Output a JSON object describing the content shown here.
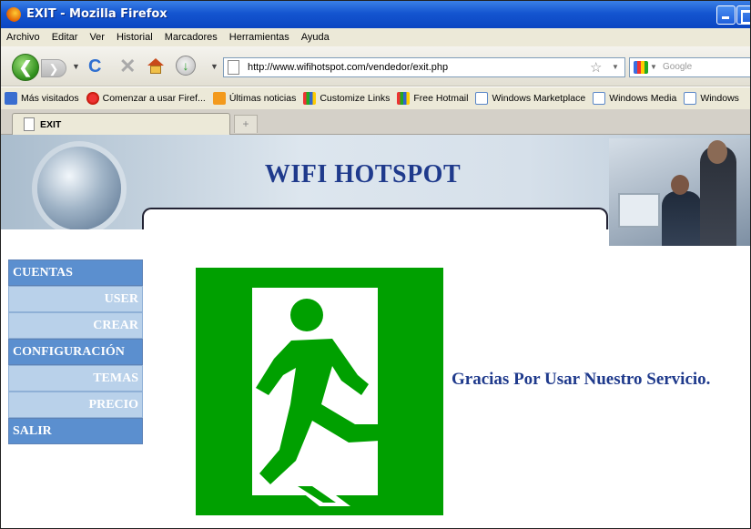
{
  "window": {
    "title": "EXIT - Mozilla Firefox"
  },
  "menubar": {
    "items": [
      "Archivo",
      "Editar",
      "Ver",
      "Historial",
      "Marcadores",
      "Herramientas",
      "Ayuda"
    ]
  },
  "navbar": {
    "url": "http://www.wifihotspot.com/vendedor/exit.php",
    "search_placeholder": "Google"
  },
  "bookmarks": {
    "items": [
      {
        "label": "Más visitados",
        "icon": "visited-icon"
      },
      {
        "label": "Comenzar a usar Firef...",
        "icon": "firefox-icon"
      },
      {
        "label": "Últimas noticias",
        "icon": "rss-icon"
      },
      {
        "label": "Customize Links",
        "icon": "windows-logo-icon"
      },
      {
        "label": "Free Hotmail",
        "icon": "windows-logo-icon"
      },
      {
        "label": "Windows Marketplace",
        "icon": "page-icon"
      },
      {
        "label": "Windows Media",
        "icon": "page-icon"
      },
      {
        "label": "Windows",
        "icon": "page-icon"
      }
    ]
  },
  "tabs": [
    {
      "label": "EXIT"
    }
  ],
  "page": {
    "banner_title": "WIFI HOTSPOT",
    "menu": [
      {
        "label": "CUENTAS",
        "level": "main"
      },
      {
        "label": "USER",
        "level": "sub"
      },
      {
        "label": "CREAR",
        "level": "sub"
      },
      {
        "label": "CONFIGURACIÓN",
        "level": "main"
      },
      {
        "label": "TEMAS",
        "level": "sub"
      },
      {
        "label": "PRECIO",
        "level": "sub"
      },
      {
        "label": "SALIR",
        "level": "main"
      }
    ],
    "thanks_message": "Gracias Por Usar Nuestro Servicio.",
    "colors": {
      "exit_sign_green": "#00a000",
      "heading_blue": "#1f3a8c",
      "menu_main": "#5b8fcf",
      "menu_sub": "#b9d1ea"
    }
  }
}
